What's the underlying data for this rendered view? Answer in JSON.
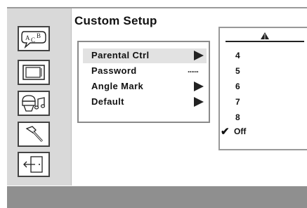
{
  "page": {
    "title": "Custom Setup"
  },
  "sidebar": {
    "items": [
      {
        "name": "language",
        "icon": "language-speech-bubble-icon",
        "glyph_a": "A",
        "glyph_c": "C",
        "glyph_b": "B"
      },
      {
        "name": "display",
        "icon": "tv-screen-icon"
      },
      {
        "name": "audio",
        "icon": "audio-speaker-music-icon"
      },
      {
        "name": "custom",
        "icon": "hammer-tool-icon"
      },
      {
        "name": "exit",
        "icon": "exit-door-icon"
      }
    ]
  },
  "menu": {
    "items": [
      {
        "label": "Parental Ctrl",
        "indicator": "arrow",
        "selected": true
      },
      {
        "label": "Password",
        "indicator": "dots",
        "value": "......",
        "selected": false
      },
      {
        "label": "Angle Mark",
        "indicator": "arrow",
        "selected": false
      },
      {
        "label": "Default",
        "indicator": "arrow",
        "selected": false
      }
    ]
  },
  "options": {
    "header_icon": "scroll-up-arrow-icon",
    "items": [
      {
        "label": "4",
        "checked": false
      },
      {
        "label": "5",
        "checked": false
      },
      {
        "label": "6",
        "checked": false
      },
      {
        "label": "7",
        "checked": false
      },
      {
        "label": "8",
        "checked": false
      },
      {
        "label": "Off",
        "checked": true,
        "check_mark": "✔"
      }
    ]
  },
  "colors": {
    "sidebar_bg": "#d9d9d9",
    "bottom_bar": "#8f8f8f",
    "selection_highlight": "#e2e2e2",
    "text": "#111111"
  }
}
